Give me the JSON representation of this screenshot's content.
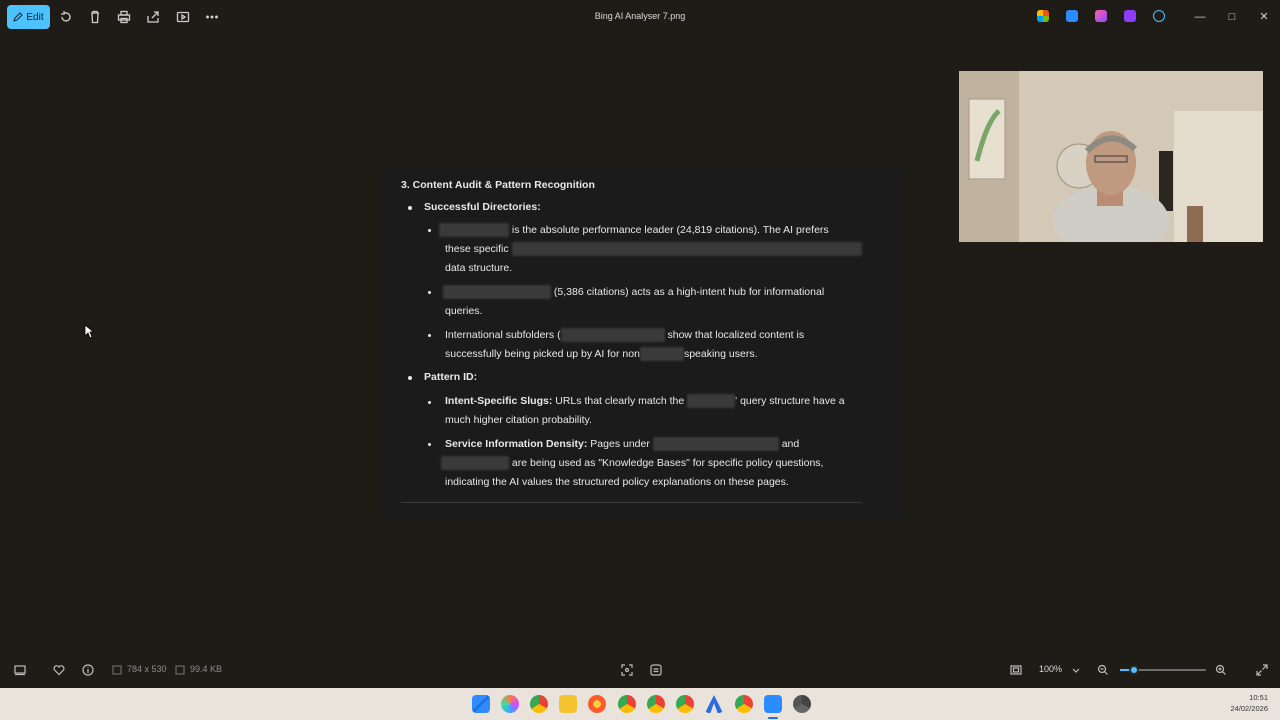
{
  "window": {
    "title": "Bing AI Analyser 7.png",
    "edit_label": "Edit"
  },
  "toolbar": {
    "icons": [
      "edit-icon",
      "rotate-icon",
      "delete-icon",
      "print-icon",
      "share-icon",
      "slideshow-icon",
      "more-icon"
    ]
  },
  "document": {
    "heading": "3. Content Audit & Pattern Recognition",
    "successful_dirs_label": "Successful Directories:",
    "item1_text_a": "is the absolute performance leader (24,819 citations). The AI prefers",
    "item1_text_b": "these specific",
    "item1_text_c": "data structure.",
    "item2_text_a": "(5,386 citations) acts as a high-intent hub for informational",
    "item2_text_b": "queries.",
    "item3_text_a": "International subfolders (",
    "item3_text_b": "show that localized content is",
    "item3_text_c": "successfully being picked up by AI for non",
    "item3_text_d": "speaking users.",
    "pattern_id_label": "Pattern ID:",
    "slugs_label": "Intent-Specific Slugs:",
    "slugs_text_a": "URLs that clearly match the",
    "slugs_text_b": "' query structure have a",
    "slugs_text_c": "much higher citation probability.",
    "density_label": "Service Information Density:",
    "density_text_a": "Pages under",
    "density_text_b": "and",
    "density_text_c": "are being used as \"Knowledge Bases\" for specific policy questions,",
    "density_text_d": "indicating the AI values the structured policy explanations on these pages."
  },
  "statusbar": {
    "dimensions": "784 x 530",
    "filesize": "99.4 KB",
    "zoom": "100%",
    "zoom_fraction": 0.16
  },
  "taskbar": {
    "time": "10:51",
    "date": "24/02/2026"
  },
  "colors": {
    "accent": "#4cc2ff",
    "background": "#1f1c18",
    "document_bg": "#1b1b1b",
    "taskbar": "#e9e3dc"
  }
}
